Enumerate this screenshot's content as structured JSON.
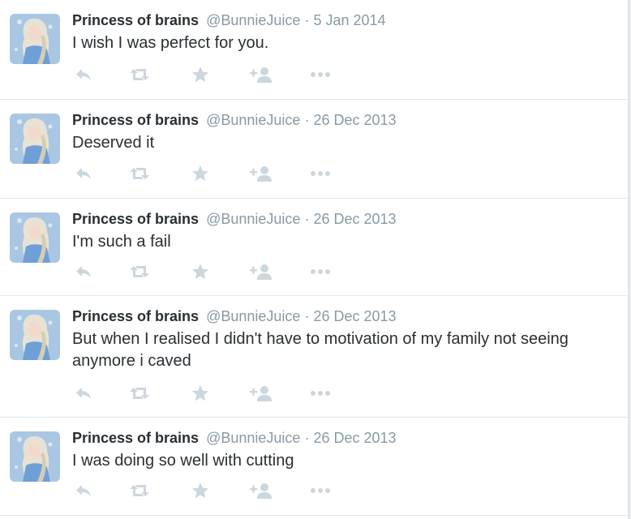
{
  "colors": {
    "name": "#292f33",
    "meta": "#8899a6",
    "icon": "#ccd6dd",
    "divider": "#e1e8ed",
    "avatar_bg": "#a9c7e3"
  },
  "icons": [
    "reply-icon",
    "retweet-icon",
    "favorite-icon",
    "follow-icon",
    "more-icon"
  ],
  "tweets": [
    {
      "fullname": "Princess of brains",
      "handle": "@BunnieJuice",
      "separator": "·",
      "time": "5 Jan 2014",
      "text": "I wish I was perfect for you."
    },
    {
      "fullname": "Princess of brains",
      "handle": "@BunnieJuice",
      "separator": "·",
      "time": "26 Dec 2013",
      "text": "Deserved it"
    },
    {
      "fullname": "Princess of brains",
      "handle": "@BunnieJuice",
      "separator": "·",
      "time": "26 Dec 2013",
      "text": "I'm such a fail"
    },
    {
      "fullname": "Princess of brains",
      "handle": "@BunnieJuice",
      "separator": "·",
      "time": "26 Dec 2013",
      "text": "But when I realised I didn't have to motivation of my family not seeing anymore i caved"
    },
    {
      "fullname": "Princess of brains",
      "handle": "@BunnieJuice",
      "separator": "·",
      "time": "26 Dec 2013",
      "text": "I was doing so well with cutting"
    }
  ]
}
